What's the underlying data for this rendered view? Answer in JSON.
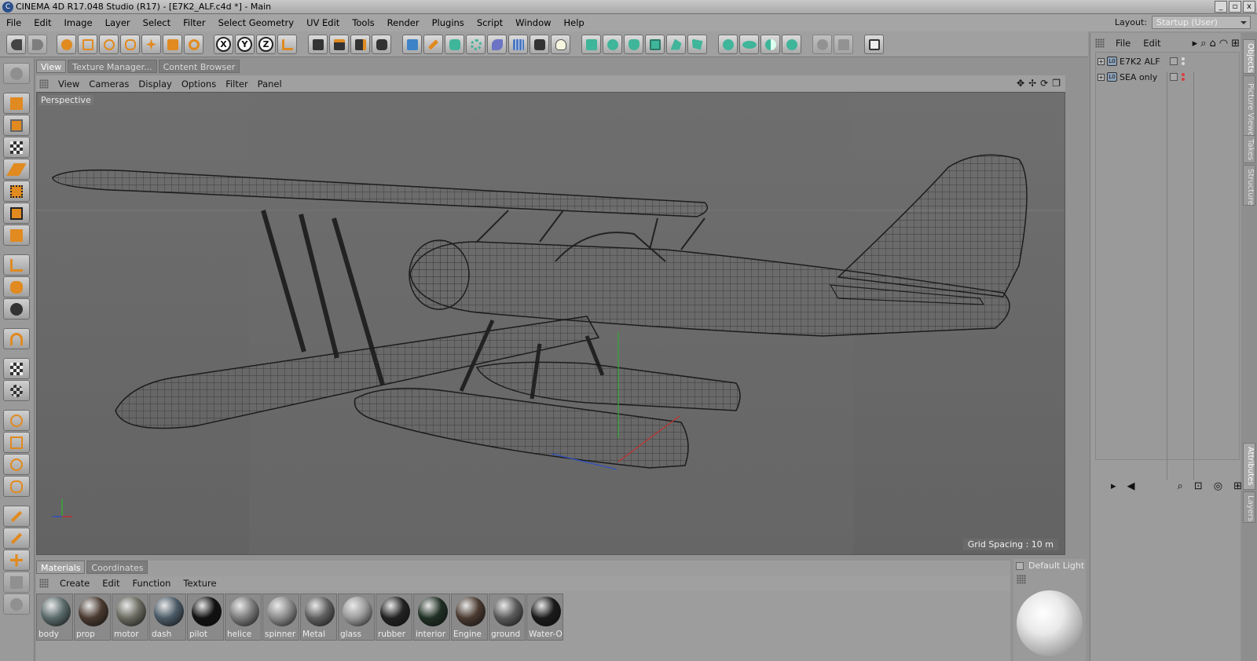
{
  "window": {
    "title": "CINEMA 4D R17.048 Studio (R17) - [E7K2_ALF.c4d *] - Main",
    "buttons": [
      "_",
      "▫",
      "x"
    ]
  },
  "menubar": [
    "File",
    "Edit",
    "Image",
    "Layer",
    "Select",
    "Filter",
    "Select Geometry",
    "UV Edit",
    "Tools",
    "Render",
    "Plugins",
    "Script",
    "Window",
    "Help"
  ],
  "layout": {
    "label": "Layout:",
    "value": "Startup (User)"
  },
  "axis_buttons": [
    "X",
    "Y",
    "Z"
  ],
  "tabs": {
    "view": "View",
    "texture_manager": "Texture Manager...",
    "content_browser": "Content Browser"
  },
  "viewport_menu": [
    "View",
    "Cameras",
    "Display",
    "Options",
    "Filter",
    "Panel"
  ],
  "viewport": {
    "label": "Perspective",
    "grid_spacing": "Grid Spacing : 10 m"
  },
  "objects_menu": [
    "File",
    "Edit"
  ],
  "objects": [
    {
      "name": "E7K2 ALF",
      "flag_color": "#d9d9d9"
    },
    {
      "name": "SEA only",
      "flag_color": "#d94040"
    }
  ],
  "side_tabs": [
    "Objects",
    "Picture Viewer",
    "Takes",
    "Structure",
    "Attributes",
    "Layers"
  ],
  "bottom_tabs": {
    "materials": "Materials",
    "coordinates": "Coordinates"
  },
  "materials_menu": [
    "Create",
    "Edit",
    "Function",
    "Texture"
  ],
  "materials": [
    {
      "name": "body",
      "color": "#5a6a6a"
    },
    {
      "name": "prop",
      "color": "#4a3a30"
    },
    {
      "name": "motor",
      "color": "#6a6a60"
    },
    {
      "name": "dash",
      "color": "#4a5a66"
    },
    {
      "name": "pilot",
      "color": "#111111"
    },
    {
      "name": "helice",
      "color": "#7a7a7a"
    },
    {
      "name": "spinner",
      "color": "#8a8a8a"
    },
    {
      "name": "Metal",
      "color": "#5f5f5f"
    },
    {
      "name": "glass",
      "color": "#9a9a9a"
    },
    {
      "name": "rubber",
      "color": "#222222"
    },
    {
      "name": "interior",
      "color": "#203025"
    },
    {
      "name": "Engine",
      "color": "#4a3a30"
    },
    {
      "name": "ground",
      "color": "#5a5a5a"
    },
    {
      "name": "Water-O",
      "color": "#1a1a1a"
    }
  ],
  "preview": {
    "label": "Default Light"
  },
  "colors": {
    "accent_orange": "#e08a20",
    "accent_green": "#3fb59a",
    "accent_blue": "#3d84c6"
  }
}
